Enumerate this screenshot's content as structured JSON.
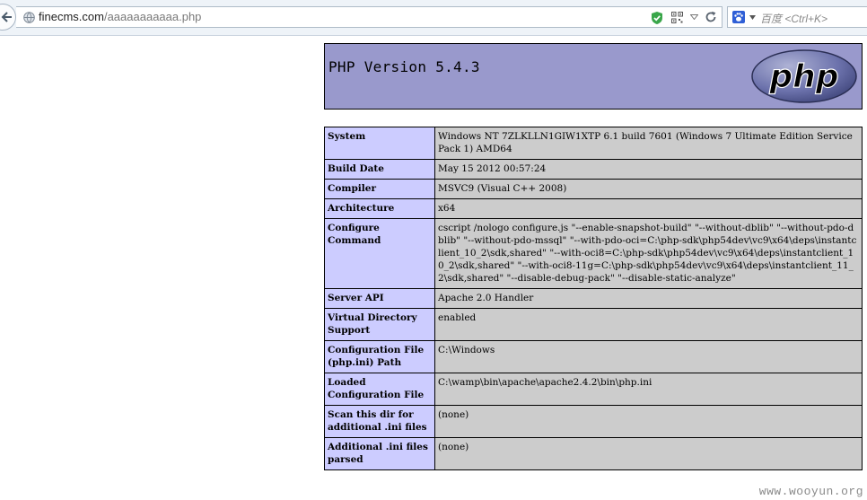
{
  "browser": {
    "url_host": "finecms.com",
    "url_path": "/aaaaaaaaaaa.php",
    "search_placeholder": "百度 <Ctrl+K>"
  },
  "php": {
    "title": "PHP Version 5.4.3",
    "logo_text": "php"
  },
  "info_rows": [
    {
      "key": "System",
      "value": "Windows NT 7ZLKLLN1GIW1XTP 6.1 build 7601 (Windows 7 Ultimate Edition Service Pack 1) AMD64"
    },
    {
      "key": "Build Date",
      "value": "May 15 2012 00:57:24"
    },
    {
      "key": "Compiler",
      "value": "MSVC9 (Visual C++ 2008)"
    },
    {
      "key": "Architecture",
      "value": "x64"
    },
    {
      "key": "Configure Command",
      "value": "cscript /nologo configure.js \"--enable-snapshot-build\" \"--without-dblib\" \"--without-pdo-dblib\" \"--without-pdo-mssql\" \"--with-pdo-oci=C:\\php-sdk\\php54dev\\vc9\\x64\\deps\\instantclient_10_2\\sdk,shared\" \"--with-oci8=C:\\php-sdk\\php54dev\\vc9\\x64\\deps\\instantclient_10_2\\sdk,shared\" \"--with-oci8-11g=C:\\php-sdk\\php54dev\\vc9\\x64\\deps\\instantclient_11_2\\sdk,shared\" \"--disable-debug-pack\" \"--disable-static-analyze\""
    },
    {
      "key": "Server API",
      "value": "Apache 2.0 Handler"
    },
    {
      "key": "Virtual Directory Support",
      "value": "enabled"
    },
    {
      "key": "Configuration File (php.ini) Path",
      "value": "C:\\Windows"
    },
    {
      "key": "Loaded Configuration File",
      "value": "C:\\wamp\\bin\\apache\\apache2.4.2\\bin\\php.ini"
    },
    {
      "key": "Scan this dir for additional .ini files",
      "value": "(none)"
    },
    {
      "key": "Additional .ini files parsed",
      "value": "(none)"
    }
  ],
  "watermark": "www.wooyun.org",
  "colors": {
    "header_bg": "#9999cc",
    "key_bg": "#ccccff",
    "value_bg": "#cccccc"
  }
}
